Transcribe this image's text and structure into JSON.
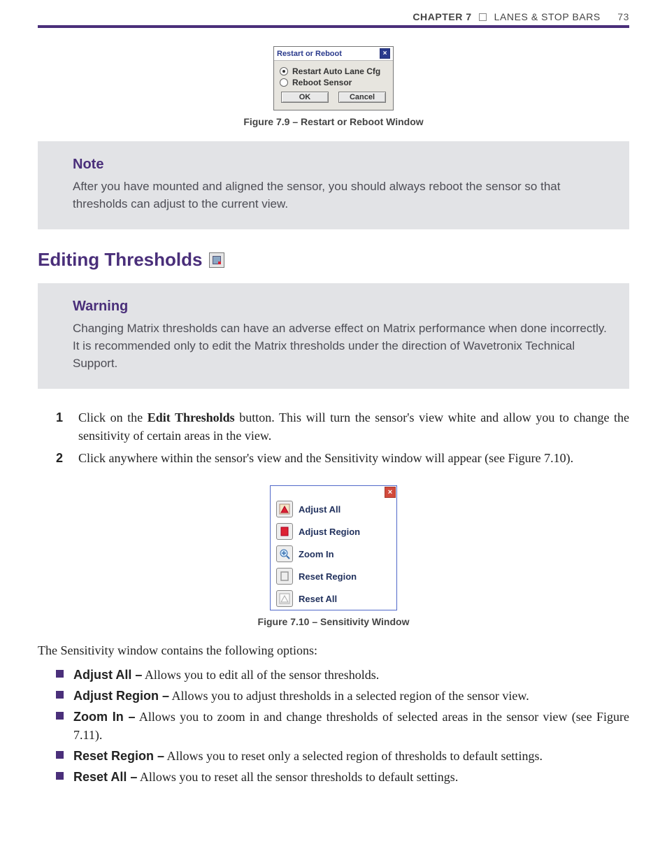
{
  "header": {
    "chapter_label": "CHAPTER 7",
    "chapter_title": "LANES & STOP BARS",
    "page_number": "73"
  },
  "figure79": {
    "title": "Restart or Reboot",
    "option_restart": "Restart Auto Lane Cfg",
    "option_reboot": "Reboot Sensor",
    "ok_label": "OK",
    "cancel_label": "Cancel",
    "caption": "Figure 7.9 – Restart or Reboot Window"
  },
  "note": {
    "heading": "Note",
    "body": "After you have mounted and aligned the sensor, you should always reboot the sensor so that thresholds can adjust to the current view."
  },
  "section_heading": "Editing Thresholds",
  "warning": {
    "heading": "Warning",
    "body": "Changing Matrix thresholds can have an adverse effect on Matrix performance when done incorrectly. It is recommended only to edit the Matrix thresholds under the direction of Wavetronix Technical Support."
  },
  "steps": {
    "s1_pre": "Click on the ",
    "s1_bold": "Edit Thresholds",
    "s1_post": " button. This will turn the sensor's view white and allow you to change the sensitivity of certain areas in the view.",
    "s2": "Click anywhere within the sensor's view and the Sensitivity window will appear (see Figure 7.10)."
  },
  "figure710": {
    "items": [
      "Adjust All",
      "Adjust Region",
      "Zoom In",
      "Reset Region",
      "Reset All"
    ],
    "caption": "Figure 7.10 – Sensitivity Window"
  },
  "intro_after": "The Sensitivity window contains the following options:",
  "bullets": {
    "b1_label": "Adjust All –",
    "b1_text": " Allows you to edit all of the sensor thresholds.",
    "b2_label": "Adjust Region –",
    "b2_text": " Allows you to adjust thresholds in a selected region of the sensor view.",
    "b3_label": "Zoom In –",
    "b3_text": " Allows you to zoom in and change thresholds of selected areas in the sensor view (see Figure 7.11).",
    "b4_label": "Reset Region –",
    "b4_text": " Allows you to reset only a selected region of thresholds to default settings.",
    "b5_label": "Reset All –",
    "b5_text": " Allows you to reset all the sensor thresholds to default settings."
  }
}
